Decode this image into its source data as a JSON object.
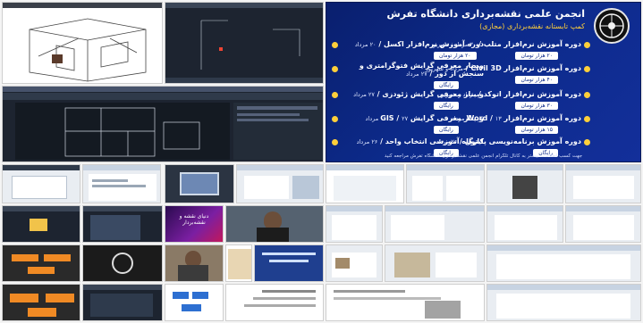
{
  "poster": {
    "title": "انجمن علمی نقشه‌برداری دانشگاه تفرش",
    "subtitle": "کمپ تابستانه نقشه‌برداری (مجازی)",
    "courses_right": [
      {
        "title": "دوره آموزش نرم‌افزار متلب",
        "date": "۳۰ مرداد و شهریور",
        "price": "۲۰ هزار تومان"
      },
      {
        "title": "دوره آموزش نرم‌افزار Civil 3D",
        "date": "مرداد و شهریور",
        "price": "۴۰ هزار تومان"
      },
      {
        "title": "دوره آموزش نرم‌افزار اتوکد",
        "date": "مرداد و شهریور",
        "price": "۳۰ هزار تومان"
      },
      {
        "title": "دوره آموزش نرم‌افزار Word",
        "date": "۱۳ مرداد",
        "price": "۱۵ هزار تومان"
      },
      {
        "title": "دوره آموزش برنامه‌نویسی پایتون",
        "date": "۲۶ مرداد",
        "price": "رایگان"
      }
    ],
    "courses_left": [
      {
        "title": "دوره آموزش نرم‌افزار اکسل",
        "date": "۲۰ مرداد",
        "price": "۲۰ هزار تومان"
      },
      {
        "title": "وبینار معرفی گرایش فتوگرامتری و سنجش از دور",
        "date": "۲۷ مرداد",
        "price": "رایگان"
      },
      {
        "title": "وبینار معرفی گرایش ژئودزی",
        "date": "۲۷ مرداد",
        "price": "رایگان"
      },
      {
        "title": "وبینار معرفی گرایش GIS",
        "date": "۲۷ مرداد",
        "price": "رایگان"
      },
      {
        "title": "کارگاه آموزشی انتخاب واحد",
        "date": "۲۶ مرداد",
        "price": "رایگان"
      }
    ],
    "footer": "جهت کسب اطلاعات بیشتر به کانال تلگرام انجمن علمی نقشه‌برداری دانشگاه تفرش مراجعه کنید"
  },
  "tiles": {
    "webinar_title": "دنیای نقشه و نقشه‌بردار"
  },
  "colors": {
    "poster_bg": "#0c2a8a",
    "accent": "#ffcf3a",
    "app_dark": "#1d2430"
  }
}
